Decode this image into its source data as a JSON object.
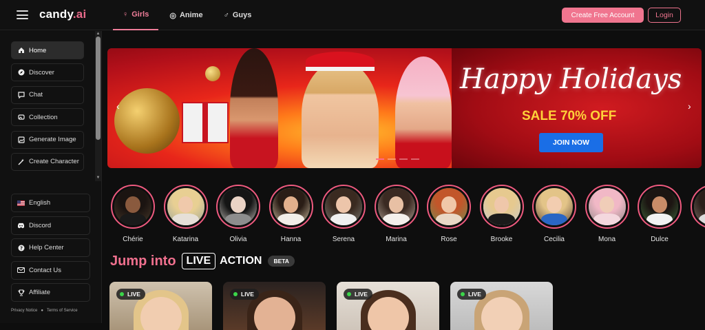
{
  "header": {
    "logo": "candy.ai",
    "tabs": [
      {
        "label": "Girls",
        "icon": "female-icon",
        "active": true
      },
      {
        "label": "Anime",
        "icon": "anime-icon",
        "active": false
      },
      {
        "label": "Guys",
        "icon": "male-icon",
        "active": false
      }
    ],
    "create_account_label": "Create Free Account",
    "login_label": "Login",
    "accent_color": "#f0758f"
  },
  "sidebar": {
    "nav": [
      {
        "label": "Home",
        "icon": "home-icon",
        "active": true
      },
      {
        "label": "Discover",
        "icon": "compass-icon",
        "active": false
      },
      {
        "label": "Chat",
        "icon": "chat-icon",
        "active": false
      },
      {
        "label": "Collection",
        "icon": "collection-icon",
        "active": false
      },
      {
        "label": "Generate Image",
        "icon": "image-icon",
        "active": false
      },
      {
        "label": "Create Character",
        "icon": "magic-wand-icon",
        "active": false
      }
    ],
    "bottom": [
      {
        "label": "English",
        "icon": "us-flag-icon"
      },
      {
        "label": "Discord",
        "icon": "discord-icon"
      },
      {
        "label": "Help Center",
        "icon": "help-icon"
      },
      {
        "label": "Contact Us",
        "icon": "mail-icon"
      },
      {
        "label": "Affiliate",
        "icon": "trophy-icon"
      }
    ],
    "privacy_label": "Privacy Notice",
    "terms_label": "Terms of Service"
  },
  "banner": {
    "headline": "Happy Holidays",
    "sale": "SALE 70% OFF",
    "cta": "JOIN NOW"
  },
  "characters": [
    "Chérie",
    "Katarina",
    "Olivia",
    "Hanna",
    "Serena",
    "Marina",
    "Rose",
    "Brooke",
    "Cecilia",
    "Mona",
    "Dulce",
    "Kr"
  ],
  "live_section": {
    "title": "Jump into",
    "live": "LIVE",
    "action": "ACTION",
    "beta": "BETA",
    "badge": "LIVE"
  }
}
